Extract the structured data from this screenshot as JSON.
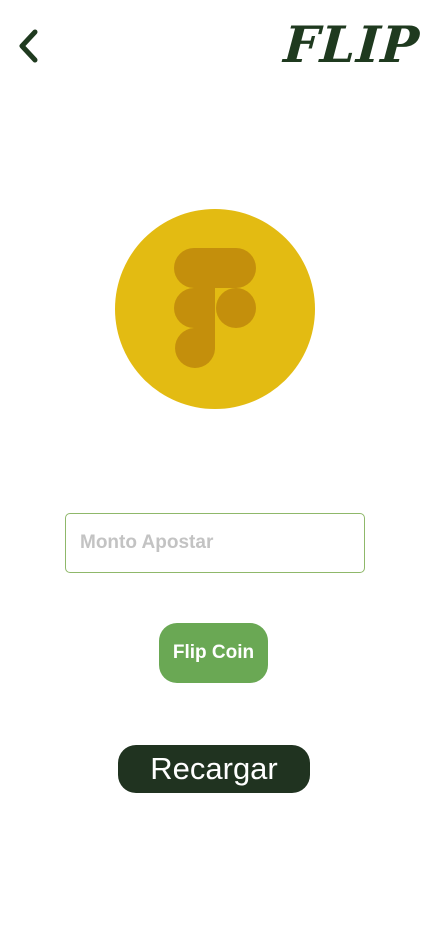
{
  "header": {
    "back_icon": "chevron-left-icon",
    "logo_text": "FLIP"
  },
  "coin": {
    "icon": "figma-f-logo-icon",
    "color": "#e3bb12",
    "glyph_color": "#c48f0c"
  },
  "bet": {
    "placeholder": "Monto Apostar",
    "value": ""
  },
  "actions": {
    "flip_label": "Flip Coin",
    "reload_label": "Recargar"
  },
  "colors": {
    "brand_dark": "#1f3a1f",
    "flip_green": "#6aa854",
    "reload_dark": "#203320",
    "input_border": "#8fb86a"
  }
}
